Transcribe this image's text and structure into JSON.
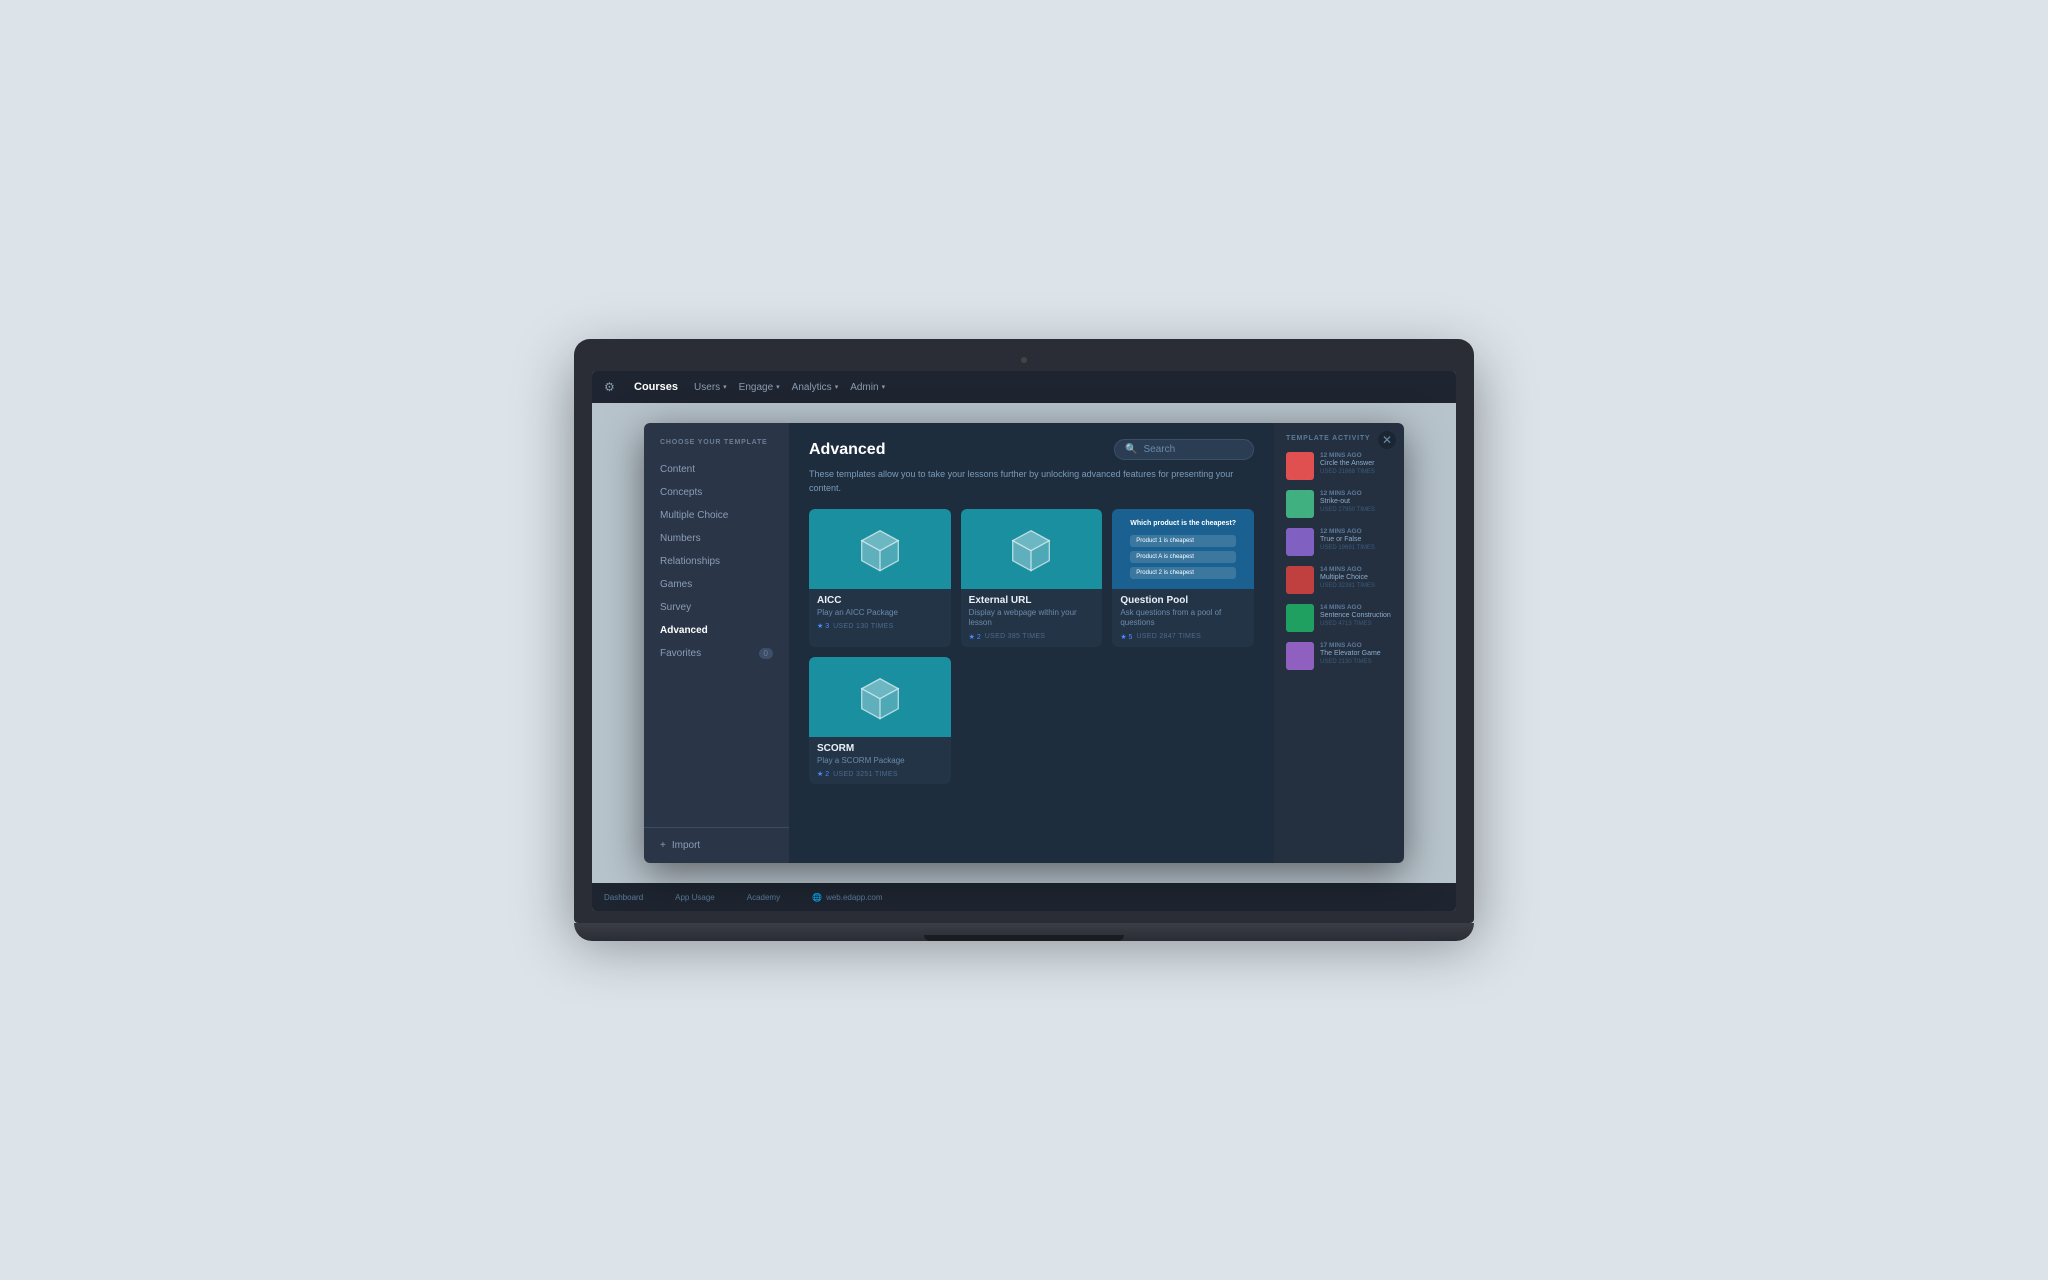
{
  "nav": {
    "brand": "Courses",
    "items": [
      {
        "label": "Users",
        "has_dropdown": true
      },
      {
        "label": "Engage",
        "has_dropdown": true
      },
      {
        "label": "Analytics",
        "has_dropdown": true
      },
      {
        "label": "Admin",
        "has_dropdown": true
      }
    ]
  },
  "sidebar": {
    "heading": "CHOOSE YOUR TEMPLATE",
    "items": [
      {
        "label": "Content",
        "active": false
      },
      {
        "label": "Concepts",
        "active": false
      },
      {
        "label": "Multiple Choice",
        "active": false
      },
      {
        "label": "Numbers",
        "active": false
      },
      {
        "label": "Relationships",
        "active": false
      },
      {
        "label": "Games",
        "active": false
      },
      {
        "label": "Survey",
        "active": false
      },
      {
        "label": "Advanced",
        "active": true
      },
      {
        "label": "Favorites",
        "active": false,
        "badge": "0"
      }
    ],
    "import_label": "Import"
  },
  "content": {
    "title": "Advanced",
    "search_placeholder": "Search",
    "description": "These templates allow you to take your lessons further by unlocking advanced features for presenting your content.",
    "templates": [
      {
        "name": "AICC",
        "description": "Play an AICC Package",
        "stars": 3,
        "used": "USED 130 TIMES",
        "thumb_style": "teal"
      },
      {
        "name": "External URL",
        "description": "Display a webpage within your lesson",
        "stars": 2,
        "used": "USED 385 TIMES",
        "thumb_style": "teal"
      },
      {
        "name": "Question Pool",
        "description": "Ask questions from a pool of questions",
        "stars": 5,
        "used": "USED 2847 TIMES",
        "thumb_style": "blue"
      },
      {
        "name": "SCORM",
        "description": "Play a SCORM Package",
        "stars": 2,
        "used": "USED 3251 TIMES",
        "thumb_style": "teal"
      }
    ]
  },
  "activity": {
    "title": "TEMPLATE ACTIVITY",
    "items": [
      {
        "time": "12 MINS AGO",
        "name": "Circle the Answer",
        "used": "USED 21868 TIMES",
        "color": "#e05050"
      },
      {
        "time": "12 MINS AGO",
        "name": "Strike-out",
        "used": "USED 27950 TIMES",
        "color": "#40b080"
      },
      {
        "time": "12 MINS AGO",
        "name": "True or False",
        "used": "USED 19691 TIMES",
        "color": "#8060c0"
      },
      {
        "time": "14 MINS AGO",
        "name": "Multiple Choice",
        "used": "USED 32381 TIMES",
        "color": "#c04040"
      },
      {
        "time": "14 MINS AGO",
        "name": "Sentence Construction",
        "used": "USED 4713 TIMES",
        "color": "#20a060"
      },
      {
        "time": "17 MINS AGO",
        "name": "The Elevator Game",
        "used": "USED 2130 TIMES",
        "color": "#9060c0"
      }
    ]
  },
  "bottom_bar": {
    "items": [
      "Dashboard",
      "App Usage",
      "Academy"
    ],
    "link": "web.edapp.com"
  }
}
